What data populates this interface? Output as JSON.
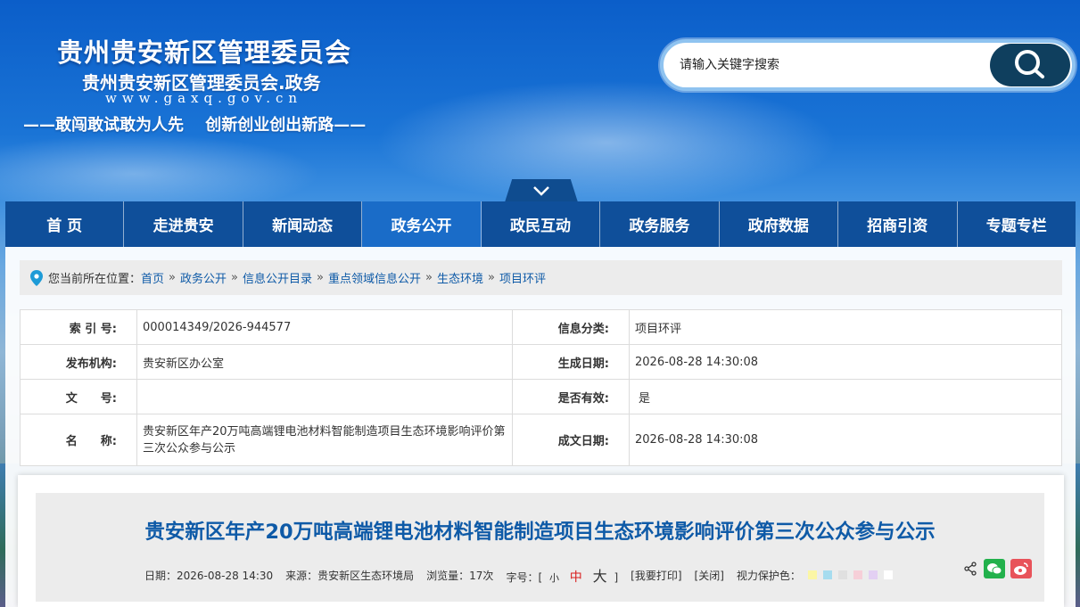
{
  "header": {
    "title": "贵州贵安新区管理委员会",
    "subtitle": "贵州贵安新区管理委员会.政务",
    "url": "www.gaxq.gov.cn",
    "slogan": "——敢闯敢试敢为人先　 创新创业创出新路——"
  },
  "search": {
    "placeholder": "请输入关键字搜索",
    "icon": "search-icon"
  },
  "nav": {
    "toggle_icon": "chevron-down-icon",
    "items": [
      "首 页",
      "走进贵安",
      "新闻动态",
      "政务公开",
      "政民互动",
      "政务服务",
      "政府数据",
      "招商引资",
      "专题专栏"
    ],
    "active_index": 3
  },
  "breadcrumb": {
    "prefix": "您当前所在位置：",
    "items": [
      "首页",
      "政务公开",
      "信息公开目录",
      "重点领域信息公开",
      "生态环境",
      "项目环评"
    ],
    "separator": "»",
    "icon": "location-pin-icon"
  },
  "meta": {
    "index_label": "索 引 号:",
    "index_value": "000014349/2026-944577",
    "category_label": "信息分类:",
    "category_value": "项目环评",
    "org_label": "发布机构:",
    "org_value": "贵安新区办公室",
    "created_label": "生成日期:",
    "created_value": "2026-08-28 14:30:08",
    "docno_label": "文　　号:",
    "docno_value": "",
    "valid_label": "是否有效:",
    "valid_value": "是",
    "name_label": "名　　称:",
    "name_value": "贵安新区年产20万吨高端锂电池材料智能制造项目生态环境影响评价第三次公众参与公示",
    "finished_label": "成文日期:",
    "finished_value": "2026-08-28 14:30:08"
  },
  "article": {
    "title": "贵安新区年产20万吨高端锂电池材料智能制造项目生态环境影响评价第三次公众参与公示",
    "date": "日期：2026-08-28 14:30",
    "source": "来源：贵安新区生态环境局",
    "views": "浏览量：17次",
    "font_label": "字号：[",
    "font_small": "小",
    "font_mid": "中",
    "font_big": "大",
    "font_end": "]",
    "print": "[我要打印]",
    "close": "[关闭]",
    "eye_label": "视力保护色：",
    "eye_colors": [
      "#fbf6a5",
      "#a6dcef",
      "#e0e0e0",
      "#f6cfd8",
      "#e3d0f3",
      "#ffffff"
    ],
    "share_icon": "share-icon",
    "wechat_icon": "wechat-icon",
    "weibo_icon": "weibo-icon"
  },
  "colors": {
    "nav_bg": "#0f4f9a",
    "nav_active": "#1a6cc8",
    "title_blue": "#0e5aa7",
    "search_btn": "#0f3f5e"
  }
}
